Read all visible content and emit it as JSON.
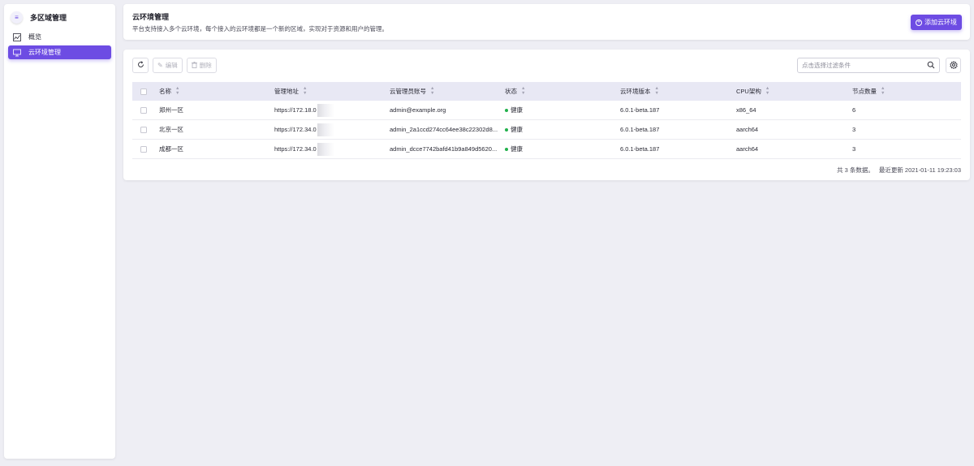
{
  "sidebar": {
    "title": "多区域管理",
    "items": [
      {
        "label": "概览",
        "icon": "chart-icon",
        "active": false
      },
      {
        "label": "云环境管理",
        "icon": "monitor-icon",
        "active": true
      }
    ]
  },
  "header": {
    "title": "云环境管理",
    "description": "平台支持接入多个云环境，每个接入的云环境都是一个新的区域，实现对于资源和用户的管理。",
    "add_button": "添加云环境"
  },
  "toolbar": {
    "edit_label": "编辑",
    "delete_label": "删除",
    "search_placeholder": "点击选择过滤条件"
  },
  "table": {
    "columns": [
      "名称",
      "管理地址",
      "云管理员账号",
      "状态",
      "云环境版本",
      "CPU架构",
      "节点数量"
    ],
    "rows": [
      {
        "name": "郑州一区",
        "address": "https://172.18.0",
        "account": "admin@example.org",
        "status": "健康",
        "version": "6.0.1-beta.187",
        "cpu": "x86_64",
        "nodes": "6"
      },
      {
        "name": "北京一区",
        "address": "https://172.34.0",
        "account": "admin_2a1ccd274cc64ee38c22302d8...",
        "status": "健康",
        "version": "6.0.1-beta.187",
        "cpu": "aarch64",
        "nodes": "3"
      },
      {
        "name": "成都一区",
        "address": "https://172.34.0",
        "account": "admin_dcce7742bafd41b9a849d5620...",
        "status": "健康",
        "version": "6.0.1-beta.187",
        "cpu": "aarch64",
        "nodes": "3"
      }
    ]
  },
  "footer": {
    "total": "共 3 条数据。",
    "updated": "最近更新  2021-01-11 19:23:03"
  },
  "colors": {
    "accent": "#6d4ce3",
    "healthy": "#22b14c"
  }
}
